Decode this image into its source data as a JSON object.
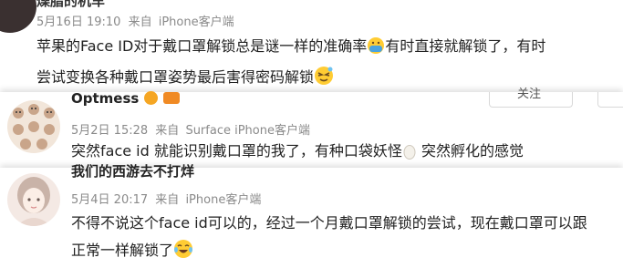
{
  "comments": [
    {
      "name": "燥脂的机车",
      "date": "5月16日 19:10",
      "via": "来自",
      "client": "iPhone客户端",
      "text_line1": "苹果的Face ID对于戴口罩解锁总是谜一样的准确率",
      "text_line1b": "有时直接就解锁了，有时",
      "text_line2": "尝试变换各种戴口罩姿势最后害得密码解锁",
      "emoji1": "mask-face-emoji",
      "emoji2": "squinting-face-emoji"
    },
    {
      "name": "Optmess",
      "date": "5月2日 15:28",
      "via": "来自",
      "client": "Surface iPhone客户端",
      "text_a": "突然face id 就能识别戴口罩的我了，有种口袋妖怪",
      "text_b": " 突然孵化的感觉",
      "emoji": "egg-emoji",
      "top_button": "关注"
    },
    {
      "name": "我们的西游去不打烊",
      "date": "5月4日 20:17",
      "via": "来自",
      "client": "iPhone客户端",
      "text_line1": "不得不说这个face id可以的，经过一个月戴口罩解锁的尝试，现在戴口罩可以跟",
      "text_line2": "正常一样解锁了",
      "emoji": "tears-of-joy-emoji"
    }
  ]
}
